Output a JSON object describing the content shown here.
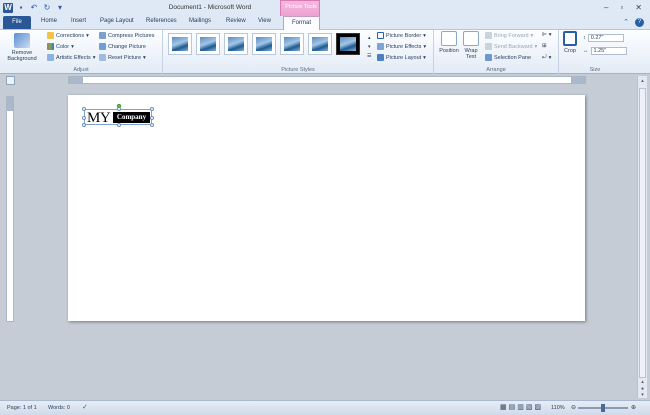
{
  "window": {
    "title": "Document1 - Microsoft Word",
    "context_tab_group": "Picture Tools"
  },
  "tabs": [
    "File",
    "Home",
    "Insert",
    "Page Layout",
    "References",
    "Mailings",
    "Review",
    "View",
    "Format"
  ],
  "ribbon": {
    "adjust": {
      "label": "Adjust",
      "remove_background": "Remove Background",
      "corrections": "Corrections",
      "color": "Color",
      "artistic_effects": "Artistic Effects",
      "compress_pictures": "Compress Pictures",
      "change_picture": "Change Picture",
      "reset_picture": "Reset Picture"
    },
    "picture_styles": {
      "label": "Picture Styles",
      "picture_border": "Picture Border",
      "picture_effects": "Picture Effects",
      "picture_layout": "Picture Layout"
    },
    "arrange": {
      "label": "Arrange",
      "position": "Position",
      "wrap_text": "Wrap Text",
      "bring_forward": "Bring Forward",
      "send_backward": "Send Backward",
      "selection_pane": "Selection Pane"
    },
    "size": {
      "label": "Size",
      "crop": "Crop",
      "height": "0.27\"",
      "width": "1.25\""
    }
  },
  "document": {
    "text_my": "MY",
    "text_company": "Company"
  },
  "status": {
    "page": "Page: 1 of 1",
    "words": "Words: 0",
    "zoom": "110%"
  },
  "colors": {
    "accent": "#2b5797",
    "context_tab": "#e990c6"
  }
}
